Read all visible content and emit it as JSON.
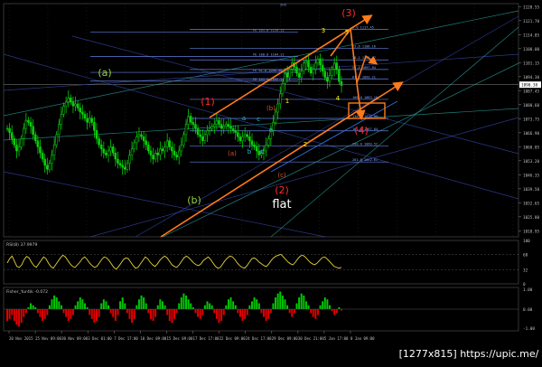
{
  "chart_data": {
    "type": "line",
    "price_panel": {
      "series_name": "",
      "price_ticks": [
        "1128.55",
        "1121.70",
        "1114.85",
        "1108.00",
        "1101.15",
        "1094.30",
        "1087.45",
        "1080.60",
        "1073.75",
        "1066.90",
        "1060.05",
        "1053.20",
        "1046.35",
        "1039.50",
        "1032.65",
        "1025.80",
        "1018.95"
      ],
      "current_price": "1090.38",
      "ylim": [
        1016,
        1130
      ],
      "close_values": [
        1069,
        1067,
        1064,
        1061,
        1058,
        1060,
        1064,
        1069,
        1073,
        1072,
        1070,
        1066,
        1063,
        1060,
        1057,
        1054,
        1051,
        1049,
        1052,
        1056,
        1061,
        1066,
        1071,
        1076,
        1080,
        1082,
        1084,
        1082,
        1080,
        1081,
        1079,
        1077,
        1076,
        1074,
        1072,
        1074,
        1072,
        1068,
        1064,
        1061,
        1059,
        1057,
        1056,
        1058,
        1060,
        1057,
        1054,
        1052,
        1051,
        1050,
        1049,
        1052,
        1056,
        1059,
        1062,
        1065,
        1066,
        1065,
        1063,
        1061,
        1058,
        1056,
        1054,
        1057,
        1056,
        1059,
        1058,
        1060,
        1063,
        1060,
        1058,
        1056,
        1055,
        1058,
        1061,
        1066,
        1071,
        1075,
        1072,
        1071,
        1069,
        1066,
        1065,
        1063,
        1066,
        1068,
        1069,
        1070,
        1071,
        1073,
        1071,
        1069,
        1070,
        1071,
        1070,
        1069,
        1068,
        1067,
        1065,
        1063,
        1065,
        1066,
        1065,
        1063,
        1061,
        1060,
        1058,
        1056,
        1057,
        1058,
        1061,
        1064,
        1068,
        1072,
        1077,
        1081,
        1086,
        1091,
        1096,
        1094,
        1098,
        1101,
        1099,
        1096,
        1094,
        1097,
        1101,
        1102,
        1099,
        1096,
        1098,
        1101,
        1103,
        1100,
        1097,
        1094,
        1092,
        1095,
        1098,
        1101,
        1098,
        1092,
        1090
      ],
      "wave_labels": {
        "a_paren": "(a)",
        "b_paren": "(b)",
        "c_paren": "(c)",
        "one": "(1)",
        "two": "(2)",
        "three": "(3)",
        "four": "(4)",
        "a": "a",
        "b": "b",
        "c": "c",
        "d": "d",
        "e": "e",
        "n1": "1",
        "n2": "2",
        "n3": "3",
        "n4": "4",
        "n5": "5",
        "flat": "flat",
        "lower_a": "(a)",
        "lower_b": "(b)",
        "lower_c": "(c)"
      },
      "fib_labels": [
        "FE 161.8 1116.12",
        "FE 100.0 1104.11",
        "FE 61.8 1096.40",
        "FE 161.8 1092.12",
        "0.0 1117.45",
        "23.6 1108.16",
        "38.2 1102.47",
        "50.0 1097.84",
        "61.8 1093.21",
        "100.0 1083.16",
        "138.2 1073.93",
        "161.8 1067.84",
        "200.0 1060.52",
        "261.8 1052.61"
      ],
      "top_label": "200"
    },
    "rsi_panel": {
      "title": "RSI(8) 37.9979",
      "ticks": [
        "100",
        "68",
        "32",
        "0"
      ],
      "values": [
        48,
        58,
        64,
        52,
        40,
        38,
        44,
        56,
        63,
        60,
        50,
        42,
        38,
        46,
        54,
        62,
        58,
        48,
        40,
        36,
        44,
        52,
        60,
        66,
        62,
        54,
        46,
        40,
        38,
        44,
        50,
        58,
        62,
        56,
        48,
        42,
        38,
        40,
        48,
        56,
        62,
        60,
        54,
        46,
        38,
        34,
        40,
        48,
        56,
        60,
        58,
        50,
        42,
        36,
        38,
        46,
        54,
        62,
        58,
        50,
        44,
        40,
        46,
        54,
        60,
        64,
        60,
        52,
        44,
        40,
        38,
        44,
        52,
        60,
        64,
        60,
        54,
        48,
        44,
        42,
        46,
        54,
        58,
        62,
        56,
        48,
        40,
        36,
        38,
        46,
        54,
        60,
        64,
        62,
        56,
        48,
        42,
        38,
        36,
        42,
        50,
        58,
        60,
        56,
        50,
        46,
        42,
        40,
        46,
        54,
        60,
        64,
        66,
        68,
        62,
        56,
        50,
        46,
        44,
        50,
        58,
        64,
        66,
        62,
        56,
        50,
        46,
        44,
        48,
        54,
        60,
        62,
        58,
        52,
        46,
        40,
        38,
        36,
        38
      ]
    },
    "fisher_panel": {
      "title": "Fisher_Yur4ik -0.072",
      "ticks": [
        "1.00",
        "0.00",
        "-1.00"
      ],
      "values": [
        -0.6,
        -0.5,
        -0.3,
        -0.6,
        -0.8,
        -0.9,
        -0.7,
        -0.4,
        -0.2,
        0.1,
        0.3,
        0.2,
        0.1,
        -0.2,
        -0.4,
        -0.6,
        -0.5,
        -0.3,
        0.2,
        0.5,
        0.7,
        0.6,
        0.4,
        0.2,
        -0.2,
        -0.4,
        -0.6,
        -0.5,
        -0.3,
        0.2,
        0.4,
        0.6,
        0.5,
        0.3,
        0.1,
        -0.3,
        -0.5,
        -0.7,
        -0.6,
        -0.4,
        0.3,
        0.5,
        0.4,
        0.2,
        -0.2,
        -0.4,
        -0.6,
        -0.3,
        0.4,
        0.6,
        0.3,
        -0.2,
        -0.5,
        -0.7,
        -0.5,
        0.2,
        0.5,
        0.7,
        0.6,
        0.3,
        -0.2,
        -0.5,
        -0.6,
        -0.4,
        0.2,
        0.5,
        0.4,
        0.2,
        -0.3,
        -0.6,
        -0.7,
        -0.5,
        -0.2,
        0.3,
        0.6,
        0.8,
        0.7,
        0.5,
        0.3,
        0.1,
        -0.2,
        -0.4,
        -0.5,
        -0.3,
        0.2,
        0.4,
        0.3,
        0.2,
        -0.2,
        -0.5,
        -0.7,
        -0.6,
        -0.3,
        0.2,
        0.5,
        0.6,
        0.4,
        0.2,
        -0.2,
        -0.4,
        -0.6,
        -0.5,
        -0.3,
        0.2,
        0.4,
        0.6,
        0.5,
        0.3,
        -0.2,
        -0.4,
        -0.6,
        -0.5,
        -0.2,
        0.3,
        0.6,
        0.8,
        0.9,
        0.7,
        0.5,
        0.2,
        -0.2,
        -0.4,
        -0.2,
        0.3,
        0.6,
        0.8,
        0.7,
        0.4,
        0.2,
        -0.2,
        -0.4,
        -0.5,
        -0.3,
        0.2,
        0.4,
        0.6,
        0.5,
        0.2,
        -0.1,
        -0.3,
        -0.2,
        0.1,
        -0.07
      ]
    },
    "x_ticks": [
      "20 Nov 2015",
      "25 Nov 09:00",
      "30 Nov 09:00",
      "3 Dec 01:00",
      "7 Dec 17:00",
      "10 Dec 09:00",
      "15 Dec 09:00",
      "17 Dec 17:00",
      "22 Dec 09:00",
      "24 Dec 17:00",
      "29 Dec 09:00",
      "30 Dec 21:00",
      "5 Jan 17:00",
      "8 Jan 09:00"
    ],
    "colors": {
      "background": "#000000",
      "grid": "#2a2a2a",
      "axis_text": "#c0c0c0",
      "up_candle": "#00d000",
      "down_candle": "#00d000",
      "price_line": "#e0e0e0",
      "rsi": "#e6d43a",
      "fisher_up": "#00c800",
      "fisher_down": "#e00000",
      "orange": "#ff7a1a",
      "red_label": "#ff2a2a",
      "yellow_label": "#f0f020",
      "green_label": "#9ad13a",
      "blue_fib": "#5f7fe0",
      "navy_line": "#3a4bb8",
      "teal_line": "#2aa6a0"
    }
  },
  "watermark": "[1277x815] https://upic.me/"
}
